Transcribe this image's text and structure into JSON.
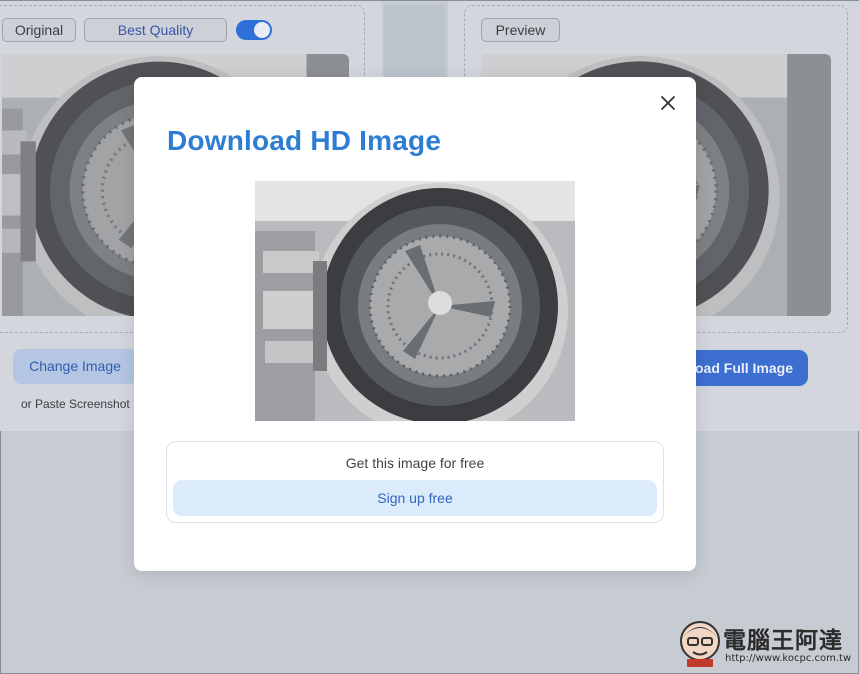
{
  "left_panel": {
    "original_label": "Original",
    "quality_label": "Best Quality",
    "toggle_on": true,
    "change_image_label": "Change Image",
    "paste_hint": "or Paste Screenshot"
  },
  "right_panel": {
    "preview_label": "Preview",
    "download_full_label": "oad Full Image"
  },
  "modal": {
    "title": "Download HD Image",
    "cta_text": "Get this image for free",
    "signup_label": "Sign up free",
    "close_icon": "close-icon"
  },
  "watermark": {
    "text": "電腦王阿達",
    "url": "http://www.kocpc.com.tw"
  },
  "colors": {
    "title": "#2d7dd2",
    "toggle": "#2e6fd8",
    "signup_bg": "#dcebfc"
  }
}
